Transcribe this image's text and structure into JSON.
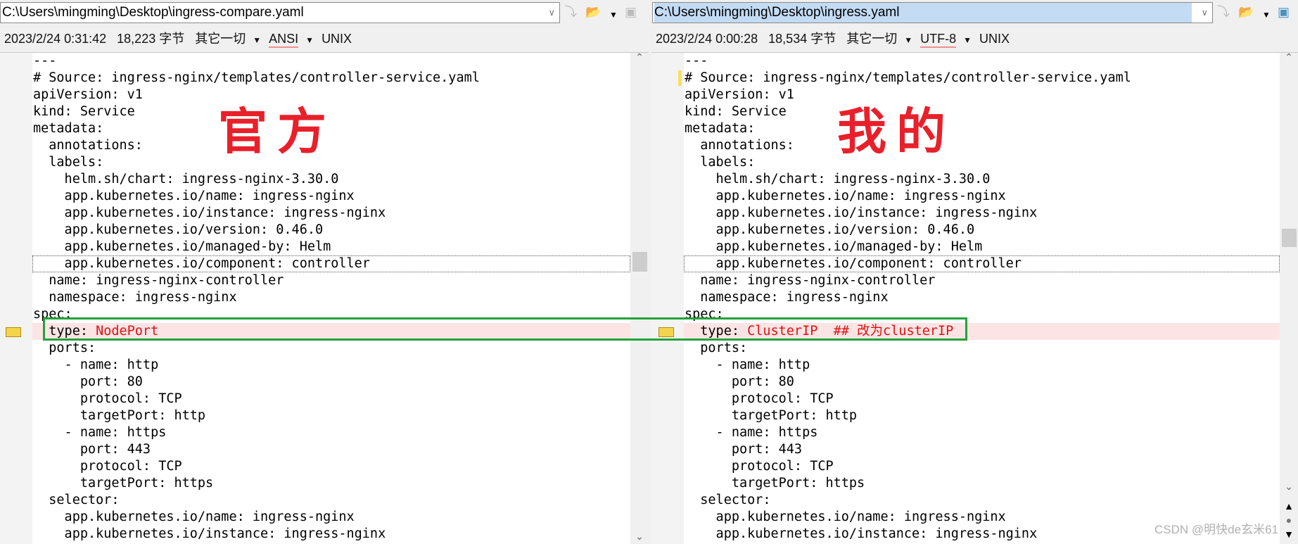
{
  "left": {
    "path": "C:\\Users\\mingming\\Desktop\\ingress-compare.yaml",
    "date": "2023/2/24 0:31:42",
    "size": "18,223 字节",
    "filter": "其它一切",
    "encoding": "ANSI",
    "eol": "UNIX",
    "overlay_label": "官方",
    "diff_value": "NodePort",
    "scroll_fraction": 0.42
  },
  "right": {
    "path": "C:\\Users\\mingming\\Desktop\\ingress.yaml",
    "date": "2023/2/24 0:00:28",
    "size": "18,534 字节",
    "filter": "其它一切",
    "encoding": "UTF-8",
    "eol": "UNIX",
    "overlay_label": "我的",
    "diff_value": "ClusterIP  ## 改为clusterIP",
    "scroll_fraction": 0.38
  },
  "lines": [
    "---",
    "# Source: ingress-nginx/templates/controller-service.yaml",
    "apiVersion: v1",
    "kind: Service",
    "metadata:",
    "  annotations:",
    "  labels:",
    "    helm.sh/chart: ingress-nginx-3.30.0",
    "    app.kubernetes.io/name: ingress-nginx",
    "    app.kubernetes.io/instance: ingress-nginx",
    "    app.kubernetes.io/version: 0.46.0",
    "    app.kubernetes.io/managed-by: Helm",
    "    app.kubernetes.io/component: controller",
    "  name: ingress-nginx-controller",
    "  namespace: ingress-nginx",
    "spec:",
    "  type: ",
    "  ports:",
    "    - name: http",
    "      port: 80",
    "      protocol: TCP",
    "      targetPort: http",
    "    - name: https",
    "      port: 443",
    "      protocol: TCP",
    "      targetPort: https",
    "  selector:",
    "    app.kubernetes.io/name: ingress-nginx",
    "    app.kubernetes.io/instance: ingress-nginx"
  ],
  "watermark": "CSDN @明快de玄米61",
  "colors": {
    "diff_bg": "#fde4e4",
    "diff_text": "#e01010",
    "highlight_box": "#22a33a",
    "overlay_text": "#e8202a"
  }
}
